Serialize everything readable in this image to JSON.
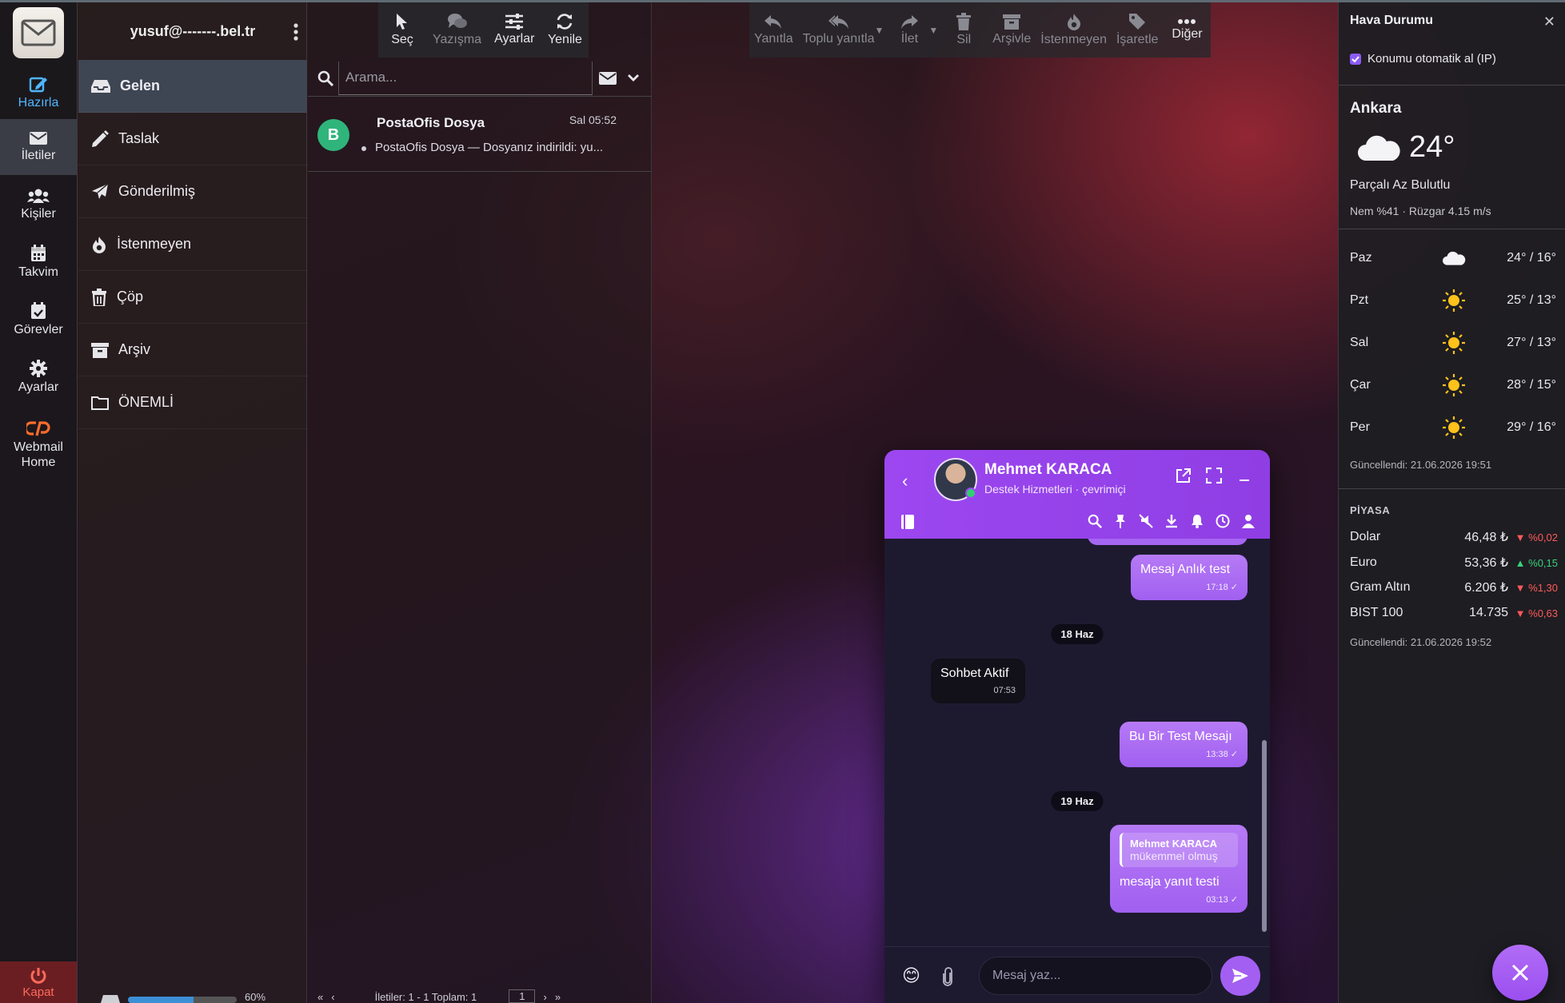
{
  "account": {
    "email": "yusuf@-------.bel.tr"
  },
  "rail": {
    "compose": "Hazırla",
    "messages": "İletiler",
    "contacts": "Kişiler",
    "calendar": "Takvim",
    "tasks": "Görevler",
    "settings": "Ayarlar",
    "webmail_line1": "Webmail",
    "webmail_line2": "Home",
    "logout": "Kapat"
  },
  "folders": [
    {
      "label": "Gelen",
      "icon": "inbox-icon"
    },
    {
      "label": "Taslak",
      "icon": "pencil-icon"
    },
    {
      "label": "Gönderilmiş",
      "icon": "paper-plane-icon"
    },
    {
      "label": "İstenmeyen",
      "icon": "fire-icon"
    },
    {
      "label": "Çöp",
      "icon": "trash-icon"
    },
    {
      "label": "Arşiv",
      "icon": "archive-icon"
    },
    {
      "label": "ÖNEMLİ",
      "icon": "folder-icon"
    }
  ],
  "quota": {
    "percent": 60,
    "label": "60%"
  },
  "list_toolbar": {
    "select": "Seç",
    "thread": "Yazışma",
    "options": "Ayarlar",
    "refresh": "Yenile"
  },
  "search": {
    "placeholder": "Arama..."
  },
  "messages": [
    {
      "avatar": "B",
      "from": "PostaOfis Dosya",
      "date": "Sal 05:52",
      "subject": "PostaOfis Dosya — Dosyanız indirildi: yu..."
    }
  ],
  "list_footer": {
    "count_text": "İletiler: 1 - 1  Toplam: 1",
    "page": "1"
  },
  "msg_toolbar": {
    "reply": "Yanıtla",
    "reply_all": "Toplu yanıtla",
    "forward": "İlet",
    "delete": "Sil",
    "archive": "Arşivle",
    "junk": "İstenmeyen",
    "mark": "İşaretle",
    "more": "Diğer"
  },
  "weather": {
    "title": "Hava Durumu",
    "auto_location": "Konumu otomatik al (IP)",
    "city": "Ankara",
    "temp": "24°",
    "condition": "Parçalı Az Bulutlu",
    "meta": "Nem %41 · Rüzgar 4.15 m/s",
    "forecast": [
      {
        "day": "Paz",
        "icon": "cloud-icon",
        "range": "24° / 16°"
      },
      {
        "day": "Pzt",
        "icon": "sun-icon",
        "range": "25° / 13°"
      },
      {
        "day": "Sal",
        "icon": "sun-icon",
        "range": "27° / 13°"
      },
      {
        "day": "Çar",
        "icon": "sun-icon",
        "range": "28° / 15°"
      },
      {
        "day": "Per",
        "icon": "sun-icon",
        "range": "29° / 16°"
      }
    ],
    "updated": "Güncellendi: 21.06.2026 19:51"
  },
  "market": {
    "title": "PİYASA",
    "rows": [
      {
        "name": "Dolar",
        "value": "46,48 ₺",
        "dir": "down",
        "change": "▼ %0,02"
      },
      {
        "name": "Euro",
        "value": "53,36 ₺",
        "dir": "up",
        "change": "▲ %0,15"
      },
      {
        "name": "Gram Altın",
        "value": "6.206 ₺",
        "dir": "down",
        "change": "▼ %1,30"
      },
      {
        "name": "BIST 100",
        "value": "14.735",
        "dir": "down",
        "change": "▼ %0,63"
      }
    ],
    "updated": "Güncellendi: 21.06.2026 19:52"
  },
  "chat": {
    "name": "Mehmet KARACA",
    "status": "Destek Hizmetleri · çevrimiçi",
    "input_placeholder": "Mesaj yaz...",
    "messages": [
      {
        "type": "out",
        "text": "Mesaj Anlık test",
        "time": "17:18 ✓"
      },
      {
        "type": "date",
        "text": "18 Haz"
      },
      {
        "type": "in",
        "text": "Sohbet Aktif",
        "time": "07:53"
      },
      {
        "type": "out",
        "text": "Bu Bir Test Mesajı",
        "time": "13:38 ✓"
      },
      {
        "type": "date",
        "text": "19 Haz"
      },
      {
        "type": "out",
        "quote_name": "Mehmet KARACA",
        "quote_text": "mükemmel olmuş",
        "text": "mesaja yanıt testi",
        "time": "03:13 ✓"
      }
    ]
  },
  "colors": {
    "accent": "#9c47f0",
    "compose": "#4fb6ff",
    "inbox_active": "#3e4553"
  }
}
